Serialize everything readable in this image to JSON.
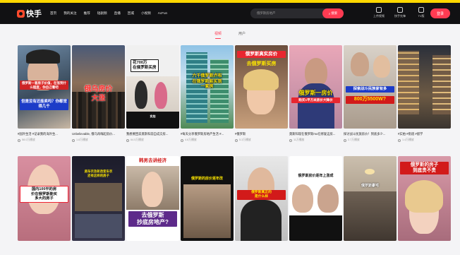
{
  "header": {
    "logo_text": "快手",
    "nav": [
      "首页",
      "我的关注",
      "推荐",
      "短剧频",
      "直播",
      "回城",
      "小视频",
      "AcFun"
    ],
    "search_placeholder": "俄罗斯房地产",
    "search_button": "搜索",
    "tools": [
      "上传视频",
      "快手先锋",
      "TV版"
    ],
    "login": "登录"
  },
  "tabs": [
    {
      "label": "视频",
      "active": true
    },
    {
      "label": "用户",
      "active": false
    }
  ],
  "row1": [
    {
      "caption": "俄罗斯一套房子价值，在涨到什么程度，你自己看吧",
      "caption2": "但是没有还能卖吗？你都觉得几千",
      "title": "#国外生活 #记录我的海外生...",
      "likes": "58.0万播放"
    },
    {
      "caption": "俄乌房价\n大涨",
      "title": "Unbelievable, 俄乌再嗨起房价...",
      "likes": "1.8万播放"
    },
    {
      "caption": "花700万\n在俄罗斯买房",
      "caption2": "实拍",
      "title": "我想要回去莫斯科前自成交房...",
      "likes": "64.5万播放"
    },
    {
      "caption": "六千俄罗斯卢布\n在俄罗斯能买到\n一套房",
      "title": "#每天分享俄罗斯房地产生活 #...",
      "likes": "4.6万播放"
    },
    {
      "caption": "俄罗斯真实房价",
      "caption2": "去俄罗斯买房",
      "title": "#俄罗斯",
      "likes": "5.3万播放"
    },
    {
      "caption": "俄罗斯一房价",
      "caption2": "购买1平方米房价大降价",
      "title": "莫斯科现在俄罗斯mo在修复这房...",
      "likes": "11万播放"
    },
    {
      "caption": "探索战斗民族家有多",
      "caption2": "800万5500W?",
      "title": "探讨战斗民族房价！到底多少...",
      "likes": "2.7万播放"
    },
    {
      "caption": "",
      "title": "#实拍 #街道 #留学",
      "likes": "1.4万播放"
    }
  ],
  "row2": [
    {
      "caption": "国内100平的房\n价在俄罗斯能买\n多大的房子"
    },
    {
      "caption": "房车衣及轮改变车衣\n还有这样的房子"
    },
    {
      "caption": "韩男去讲经济",
      "caption2": "去俄罗斯\n抄底房地产?"
    },
    {
      "caption": "俄罗斯的房价逐年改"
    },
    {
      "caption": "俄罗斯真正的\n是什么样"
    },
    {
      "caption": "俄罗斯房价逐年上涨成"
    },
    {
      "caption": "俄罗斯豪宅"
    },
    {
      "caption": "俄罗斯的房子\n到底贵不贵"
    }
  ],
  "colors": {
    "accent": "#ff3b52",
    "header_bg": "#111113",
    "yellow": "#ffd800"
  }
}
